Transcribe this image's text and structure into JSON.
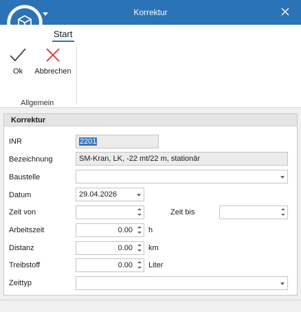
{
  "window": {
    "title": "Korrektur"
  },
  "ribbon": {
    "tab_start": "Start",
    "ok_label": "Ok",
    "cancel_label": "Abbrechen",
    "group_label": "Allgemein"
  },
  "panel": {
    "title": "Korrektur"
  },
  "form": {
    "inr_label": "INR",
    "inr_value": "2201",
    "bezeichnung_label": "Bezeichnung",
    "bezeichnung_value": "SM-Kran, LK, -22 mt/22 m, stationär",
    "baustelle_label": "Baustelle",
    "baustelle_value": "",
    "datum_label": "Datum",
    "datum_value": "29.04.2026",
    "zeit_von_label": "Zeit von",
    "zeit_von_value": "",
    "zeit_bis_label": "Zeit bis",
    "zeit_bis_value": "",
    "arbeitszeit_label": "Arbeitszeit",
    "arbeitszeit_value": "0.00",
    "arbeitszeit_unit": "h",
    "distanz_label": "Distanz",
    "distanz_value": "0.00",
    "distanz_unit": "km",
    "treibstoff_label": "Treibstoff",
    "treibstoff_value": "0.00",
    "treibstoff_unit": "Liter",
    "zeittyp_label": "Zeittyp",
    "zeittyp_value": ""
  },
  "icons": {
    "app": "cube-icon",
    "ok": "checkmark-icon",
    "cancel": "x-icon",
    "close": "close-icon"
  },
  "colors": {
    "titlebar": "#2b73b7",
    "ok_icon": "#444444",
    "cancel_icon": "#e03030"
  }
}
